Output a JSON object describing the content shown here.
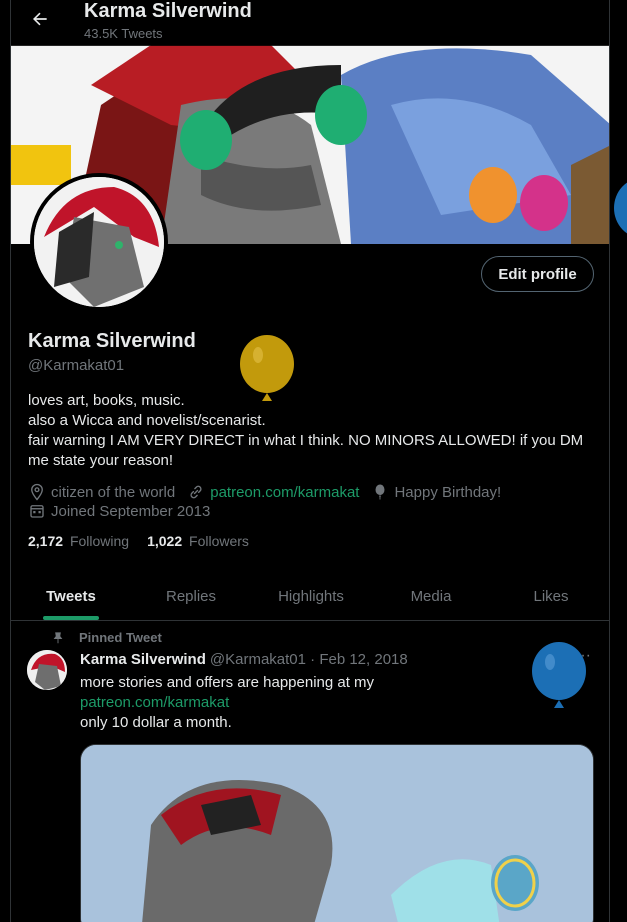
{
  "header": {
    "title": "Karma Silverwind",
    "tweet_count": "43.5K Tweets"
  },
  "profile": {
    "name": "Karma Silverwind",
    "handle": "@Karmakat01",
    "edit_button": "Edit profile",
    "bio_lines": [
      "loves art, books, music.",
      "also a Wicca and novelist/scenarist.",
      "fair warning I AM VERY DIRECT in what I think. NO MINORS ALLOWED! if you DM",
      "me state your reason!"
    ],
    "location": "citizen of the world",
    "website": "patreon.com/karmakat",
    "birthday": "Happy Birthday!",
    "joined": "Joined September 2013",
    "following_count": "2,172",
    "following_label": "Following",
    "followers_count": "1,022",
    "followers_label": "Followers"
  },
  "tabs": [
    "Tweets",
    "Replies",
    "Highlights",
    "Media",
    "Likes"
  ],
  "active_tab": "Tweets",
  "tweet": {
    "pinned_label": "Pinned Tweet",
    "author": "Karma Silverwind",
    "meta": "@Karmakat01 · Feb 12, 2018",
    "more": "···",
    "lines": [
      "more stories and offers are happening at my",
      "patreon.com/karmakat",
      "only 10 dollar a month."
    ]
  },
  "colors": {
    "background": "#000000",
    "accent": "#1d9b68",
    "secondary_text": "#71767b",
    "border": "#2f3336"
  }
}
